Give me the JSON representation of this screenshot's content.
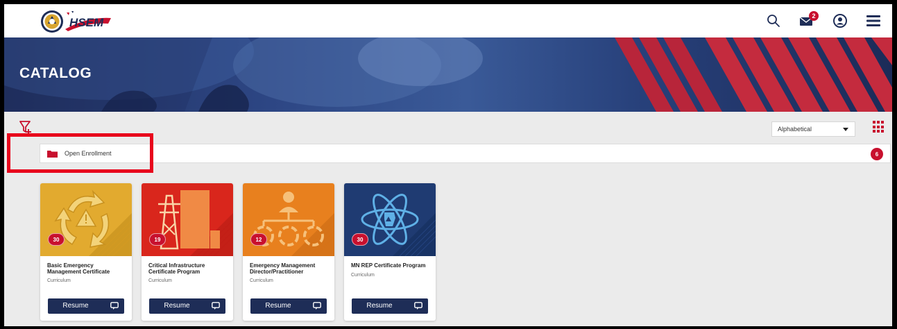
{
  "header": {
    "logo_text": "HSEM",
    "icons": [
      "search-icon",
      "mail-icon",
      "user-circle-icon",
      "hamburger-menu-icon"
    ],
    "mail_badge": "2"
  },
  "banner": {
    "title": "CATALOG"
  },
  "toolbar": {
    "sort_value": "Alphabetical",
    "filter_icon": "filter-add-icon",
    "view_icon": "grid-view-icon"
  },
  "folder": {
    "label": "Open Enrollment",
    "count": "6"
  },
  "cards": [
    {
      "title": "Basic Emergency Management Certificate",
      "type": "Curriculum",
      "count": "30",
      "button": "Resume",
      "theme": "#e0a92c"
    },
    {
      "title": "Critical Infrastructure Certificate Program",
      "type": "Curriculum",
      "count": "19",
      "button": "Resume",
      "theme": "#d9261c"
    },
    {
      "title": "Emergency Management Director/Practitioner",
      "type": "Curriculum",
      "count": "12",
      "button": "Resume",
      "theme": "#e8801e"
    },
    {
      "title": "MN REP Certificate Program",
      "type": "Curriculum",
      "count": "30",
      "button": "Resume",
      "theme": "#1f3b72"
    }
  ],
  "colors": {
    "accent": "#c8102e",
    "navy": "#1e2d57",
    "annotation": "#e8051c"
  }
}
